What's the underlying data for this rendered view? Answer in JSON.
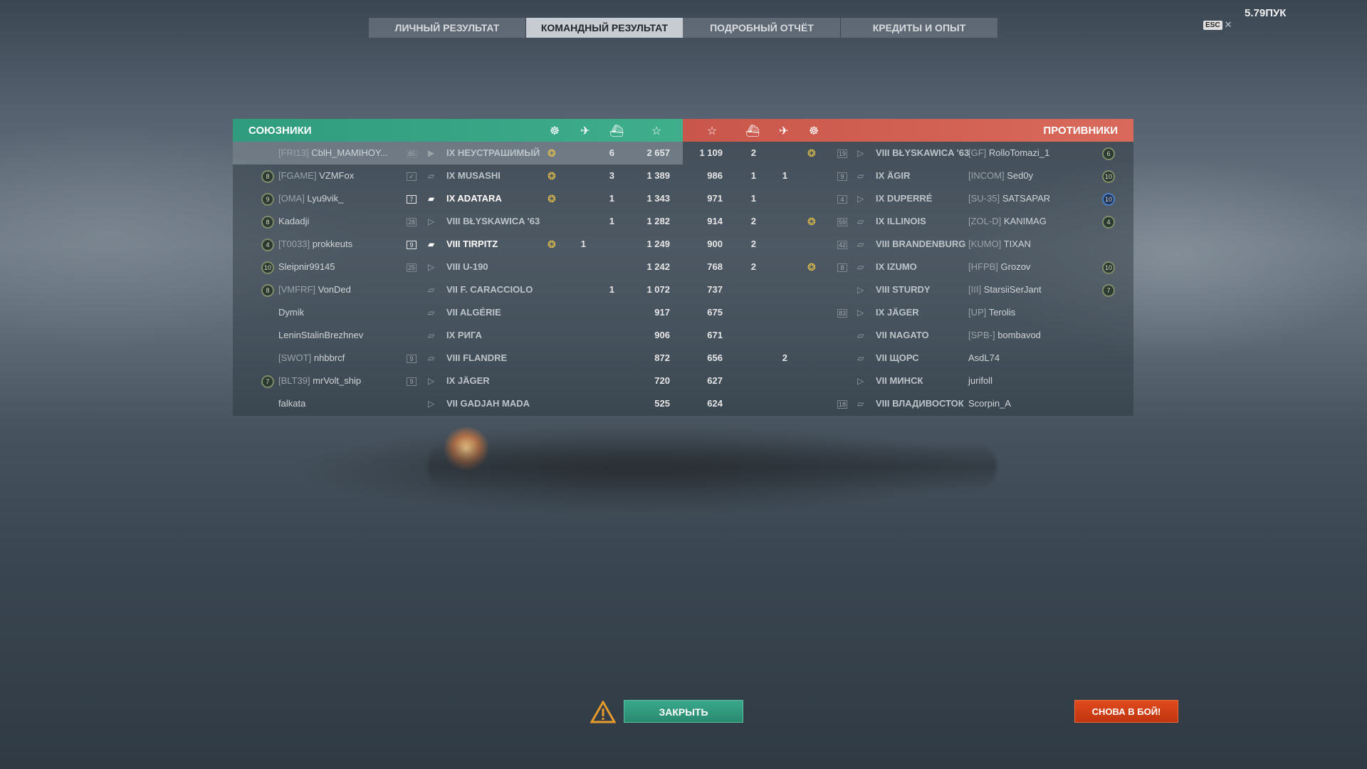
{
  "version": "5.79ПУК",
  "esc_key": "ESC",
  "close_x": "✕",
  "tabs": [
    {
      "label": "ЛИЧНЫЙ РЕЗУЛЬТАТ",
      "active": false
    },
    {
      "label": "КОМАНДНЫЙ РЕЗУЛЬТАТ",
      "active": true
    },
    {
      "label": "ПОДРОБНЫЙ ОТЧЁТ",
      "active": false
    },
    {
      "label": "КРЕДИТЫ И ОПЫТ",
      "active": false
    }
  ],
  "allies": {
    "title": "СОЮЗНИКИ",
    "header_icons": [
      "medal-icon",
      "planes-icon",
      "ship-kills-icon",
      "star-icon"
    ],
    "rows": [
      {
        "rank": "",
        "clan": "[FRI13]",
        "player": "CblH_MAMIHOY...",
        "level": "85",
        "class": "▶",
        "ship": "IX НЕУСТРАШИМЫЙ",
        "medal": "❂",
        "planes": "",
        "kills": "6",
        "exp": "2 657",
        "mine": true
      },
      {
        "rank": "8",
        "clan": "[FGAME]",
        "player": "VZMFox",
        "level": "✓",
        "class": "▱",
        "ship": "IX MUSASHI",
        "medal": "❂",
        "planes": "",
        "kills": "3",
        "exp": "1 389"
      },
      {
        "rank": "9",
        "clan": "[OMA]",
        "player": "Lyu9vik_",
        "level": "7",
        "class": "▰",
        "ship": "IX ADATARA",
        "medal": "❂",
        "planes": "",
        "kills": "1",
        "exp": "1 343",
        "bright": true
      },
      {
        "rank": "8",
        "clan": "",
        "player": "Kadadji",
        "level": "28",
        "class": "▷",
        "ship": "VIII BŁYSKAWICA '63",
        "medal": "",
        "planes": "",
        "kills": "1",
        "exp": "1 282"
      },
      {
        "rank": "4",
        "clan": "[T0033]",
        "player": "prokkeuts",
        "level": "9",
        "class": "▰",
        "ship": "VIII TIRPITZ",
        "medal": "❂",
        "planes": "1",
        "kills": "",
        "exp": "1 249",
        "bright": true
      },
      {
        "rank": "10",
        "clan": "",
        "player": "Sleipnir99145",
        "level": "25",
        "class": "▷",
        "ship": "VIII U-190",
        "medal": "",
        "planes": "",
        "kills": "",
        "exp": "1 242"
      },
      {
        "rank": "8",
        "clan": "[VMFRF]",
        "player": "VonDed",
        "level": "",
        "class": "▱",
        "ship": "VII F. CARACCIOLO",
        "medal": "",
        "planes": "",
        "kills": "1",
        "exp": "1 072"
      },
      {
        "rank": "",
        "clan": "",
        "player": "Dymik",
        "level": "",
        "class": "▱",
        "ship": "VII ALGÉRIE",
        "medal": "",
        "planes": "",
        "kills": "",
        "exp": "917"
      },
      {
        "rank": "",
        "clan": "",
        "player": "LeninStalinBrezhnev",
        "level": "",
        "class": "▱",
        "ship": "IX РИГА",
        "medal": "",
        "planes": "",
        "kills": "",
        "exp": "906"
      },
      {
        "rank": "",
        "clan": "[SWOT]",
        "player": "nhbbrcf",
        "level": "9",
        "class": "▱",
        "ship": "VIII FLANDRE",
        "medal": "",
        "planes": "",
        "kills": "",
        "exp": "872"
      },
      {
        "rank": "7",
        "clan": "[BLT39]",
        "player": "mrVolt_ship",
        "level": "9",
        "class": "▷",
        "ship": "IX JÄGER",
        "medal": "",
        "planes": "",
        "kills": "",
        "exp": "720"
      },
      {
        "rank": "",
        "clan": "",
        "player": "falkata",
        "level": "",
        "class": "▷",
        "ship": "VII GADJAH MADA",
        "medal": "",
        "planes": "",
        "kills": "",
        "exp": "525"
      }
    ]
  },
  "enemies": {
    "title": "ПРОТИВНИКИ",
    "header_icons": [
      "star-icon",
      "ship-kills-icon",
      "planes-icon",
      "medal-icon"
    ],
    "rows": [
      {
        "exp": "1 109",
        "kills": "2",
        "planes": "",
        "medal": "❂",
        "level": "19",
        "class": "▷",
        "ship": "VIII BŁYSKAWICA '63",
        "clan": "[GF]",
        "player": "RolloTomazi_1",
        "rank": "6"
      },
      {
        "exp": "986",
        "kills": "1",
        "planes": "1",
        "medal": "",
        "level": "9",
        "class": "▱",
        "ship": "IX ÄGIR",
        "clan": "[INCOM]",
        "player": "Sed0y",
        "rank": "10"
      },
      {
        "exp": "971",
        "kills": "1",
        "planes": "",
        "medal": "",
        "level": "4",
        "class": "▷",
        "ship": "IX DUPERRÉ",
        "clan": "[SU-35]",
        "player": "SATSAPAR",
        "rank": "10",
        "rank_blue": true
      },
      {
        "exp": "914",
        "kills": "2",
        "planes": "",
        "medal": "❂",
        "level": "59",
        "class": "▱",
        "ship": "IX ILLINOIS",
        "clan": "[ZOL-D]",
        "player": "KANIMAG",
        "rank": "4"
      },
      {
        "exp": "900",
        "kills": "2",
        "planes": "",
        "medal": "",
        "level": "42",
        "class": "▱",
        "ship": "VIII BRANDENBURG",
        "clan": "[KUMO]",
        "player": "TIXAN",
        "rank": ""
      },
      {
        "exp": "768",
        "kills": "2",
        "planes": "",
        "medal": "❂",
        "level": "8",
        "class": "▱",
        "ship": "IX IZUMO",
        "clan": "[HFPB]",
        "player": "Grozov",
        "rank": "10"
      },
      {
        "exp": "737",
        "kills": "",
        "planes": "",
        "medal": "",
        "level": "",
        "class": "▷",
        "ship": "VIII STURDY",
        "clan": "[III]",
        "player": "StarsiiSerJant",
        "rank": "7"
      },
      {
        "exp": "675",
        "kills": "",
        "planes": "",
        "medal": "",
        "level": "83",
        "class": "▷",
        "ship": "IX JÄGER",
        "clan": "[UP]",
        "player": "Terolis",
        "rank": ""
      },
      {
        "exp": "671",
        "kills": "",
        "planes": "",
        "medal": "",
        "level": "",
        "class": "▱",
        "ship": "VII NAGATO",
        "clan": "[SPB-]",
        "player": "bombavod",
        "rank": ""
      },
      {
        "exp": "656",
        "kills": "",
        "planes": "2",
        "medal": "",
        "level": "",
        "class": "▱",
        "ship": "VII ЩОРС",
        "clan": "",
        "player": "AsdL74",
        "rank": ""
      },
      {
        "exp": "627",
        "kills": "",
        "planes": "",
        "medal": "",
        "level": "",
        "class": "▷",
        "ship": "VII МИНСК",
        "clan": "",
        "player": "jurifoll",
        "rank": ""
      },
      {
        "exp": "624",
        "kills": "",
        "planes": "",
        "medal": "",
        "level": "18",
        "class": "▱",
        "ship": "VIII ВЛАДИВОСТОК",
        "clan": "",
        "player": "Scorpin_A",
        "rank": ""
      }
    ]
  },
  "buttons": {
    "close": "ЗАКРЫТЬ",
    "again": "СНОВА В БОЙ!"
  },
  "colors": {
    "allies_header": "#3aa886",
    "enemies_header": "#d2604f",
    "close_button": "#2e9a7c",
    "again_button": "#d0401a"
  }
}
